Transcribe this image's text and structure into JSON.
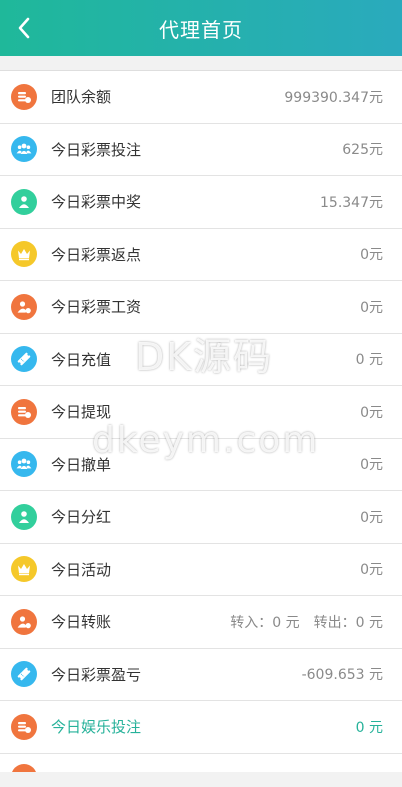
{
  "header": {
    "title": "代理首页"
  },
  "colors": {
    "orange": "#f0753e",
    "blue": "#36b8ee",
    "green": "#32cf9c",
    "yellow": "#f5c82a",
    "highlight": "#26b29a"
  },
  "rows": [
    {
      "label": "团队余额",
      "value": "999390.347元",
      "icon": "coins-icon",
      "color": "orange"
    },
    {
      "label": "今日彩票投注",
      "value": "625元",
      "icon": "users-icon",
      "color": "blue"
    },
    {
      "label": "今日彩票中奖",
      "value": "15.347元",
      "icon": "person-icon",
      "color": "green"
    },
    {
      "label": "今日彩票返点",
      "value": "0元",
      "icon": "crown-icon",
      "color": "yellow"
    },
    {
      "label": "今日彩票工资",
      "value": "0元",
      "icon": "person-coin-icon",
      "color": "orange"
    },
    {
      "label": "今日充值",
      "value": "0 元",
      "icon": "ticket-icon",
      "color": "blue"
    },
    {
      "label": "今日提现",
      "value": "0元",
      "icon": "coins-icon",
      "color": "orange"
    },
    {
      "label": "今日撤单",
      "value": "0元",
      "icon": "users-icon",
      "color": "blue"
    },
    {
      "label": "今日分红",
      "value": "0元",
      "icon": "person-icon",
      "color": "green"
    },
    {
      "label": "今日活动",
      "value": "0元",
      "icon": "crown-icon",
      "color": "yellow"
    },
    {
      "label": "今日转账",
      "value_in": "转入：0 元",
      "value_out": "转出：0 元",
      "icon": "person-coin-icon",
      "color": "orange"
    },
    {
      "label": "今日彩票盈亏",
      "value": "-609.653 元",
      "icon": "ticket-icon",
      "color": "blue"
    },
    {
      "label": "今日娱乐投注",
      "value": "0 元",
      "icon": "coins-icon",
      "color": "orange",
      "highlight": true
    }
  ],
  "watermark": {
    "line1": "DK源码",
    "line2": "dkeym.com"
  }
}
